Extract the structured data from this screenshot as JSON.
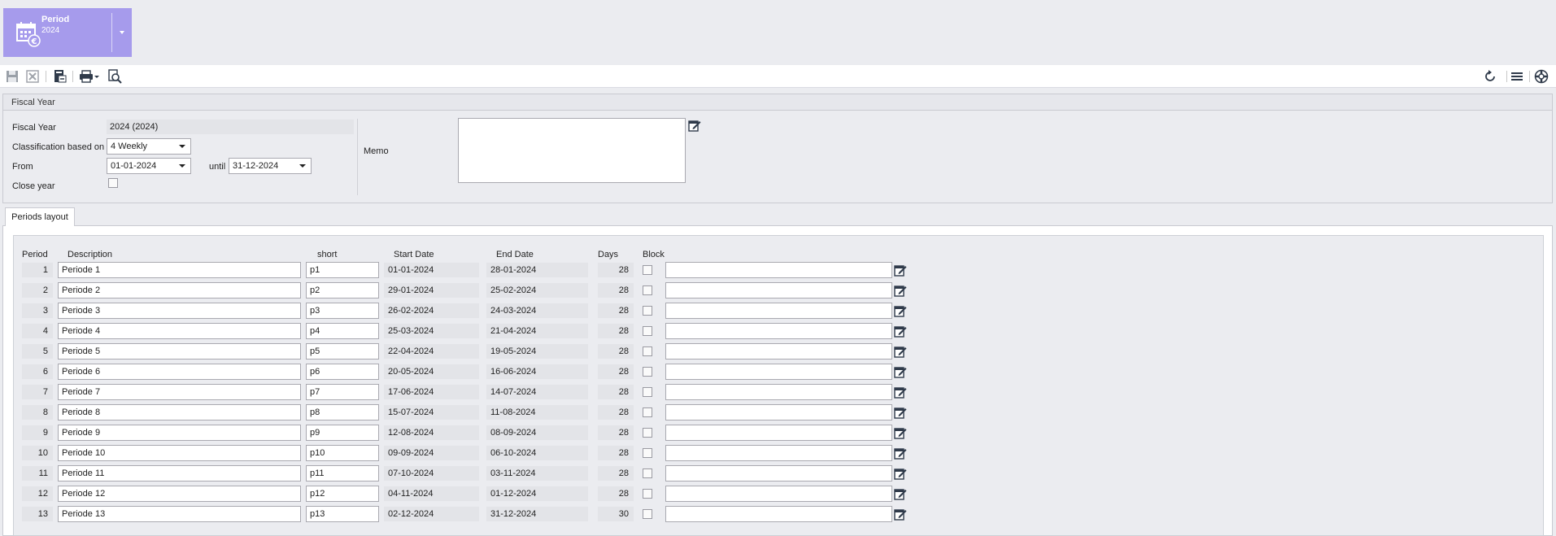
{
  "tile": {
    "title": "Period",
    "subtitle": "2024",
    "icon": "calendar-euro-icon"
  },
  "toolbar": {
    "left_icons": [
      "save-icon",
      "discard-icon",
      "export-icon",
      "print-icon",
      "preview-icon"
    ],
    "right_icons": [
      "refresh-icon",
      "menu-icon",
      "help-icon"
    ]
  },
  "fiscal_year": {
    "header": "Fiscal Year",
    "fiscal_year_label": "Fiscal Year",
    "fiscal_year_value": "2024 (2024)",
    "classification_label": "Classification based on",
    "classification_value": "4 Weekly",
    "from_label": "From",
    "from_value": "01-01-2024",
    "until_label": "until",
    "until_value": "31-12-2024",
    "close_year_label": "Close year",
    "memo_label": "Memo"
  },
  "tabs": [
    {
      "label": "Periods layout"
    }
  ],
  "periods": {
    "headers": {
      "period": "Period",
      "description": "Description",
      "short": "short",
      "start": "Start Date",
      "end": "End Date",
      "days": "Days",
      "block": "Block"
    },
    "rows": [
      {
        "period": "1",
        "description": "Periode 1",
        "short": "p1",
        "start": "01-01-2024",
        "end": "28-01-2024",
        "days": "28"
      },
      {
        "period": "2",
        "description": "Periode 2",
        "short": "p2",
        "start": "29-01-2024",
        "end": "25-02-2024",
        "days": "28"
      },
      {
        "period": "3",
        "description": "Periode 3",
        "short": "p3",
        "start": "26-02-2024",
        "end": "24-03-2024",
        "days": "28"
      },
      {
        "period": "4",
        "description": "Periode 4",
        "short": "p4",
        "start": "25-03-2024",
        "end": "21-04-2024",
        "days": "28"
      },
      {
        "period": "5",
        "description": "Periode 5",
        "short": "p5",
        "start": "22-04-2024",
        "end": "19-05-2024",
        "days": "28"
      },
      {
        "period": "6",
        "description": "Periode 6",
        "short": "p6",
        "start": "20-05-2024",
        "end": "16-06-2024",
        "days": "28"
      },
      {
        "period": "7",
        "description": "Periode 7",
        "short": "p7",
        "start": "17-06-2024",
        "end": "14-07-2024",
        "days": "28"
      },
      {
        "period": "8",
        "description": "Periode 8",
        "short": "p8",
        "start": "15-07-2024",
        "end": "11-08-2024",
        "days": "28"
      },
      {
        "period": "9",
        "description": "Periode 9",
        "short": "p9",
        "start": "12-08-2024",
        "end": "08-09-2024",
        "days": "28"
      },
      {
        "period": "10",
        "description": "Periode 10",
        "short": "p10",
        "start": "09-09-2024",
        "end": "06-10-2024",
        "days": "28"
      },
      {
        "period": "11",
        "description": "Periode 11",
        "short": "p11",
        "start": "07-10-2024",
        "end": "03-11-2024",
        "days": "28"
      },
      {
        "period": "12",
        "description": "Periode 12",
        "short": "p12",
        "start": "04-11-2024",
        "end": "01-12-2024",
        "days": "28"
      },
      {
        "period": "13",
        "description": "Periode 13",
        "short": "p13",
        "start": "02-12-2024",
        "end": "31-12-2024",
        "days": "30"
      }
    ]
  },
  "colors": {
    "tile": "#a69bec",
    "background": "#ebecf0"
  }
}
